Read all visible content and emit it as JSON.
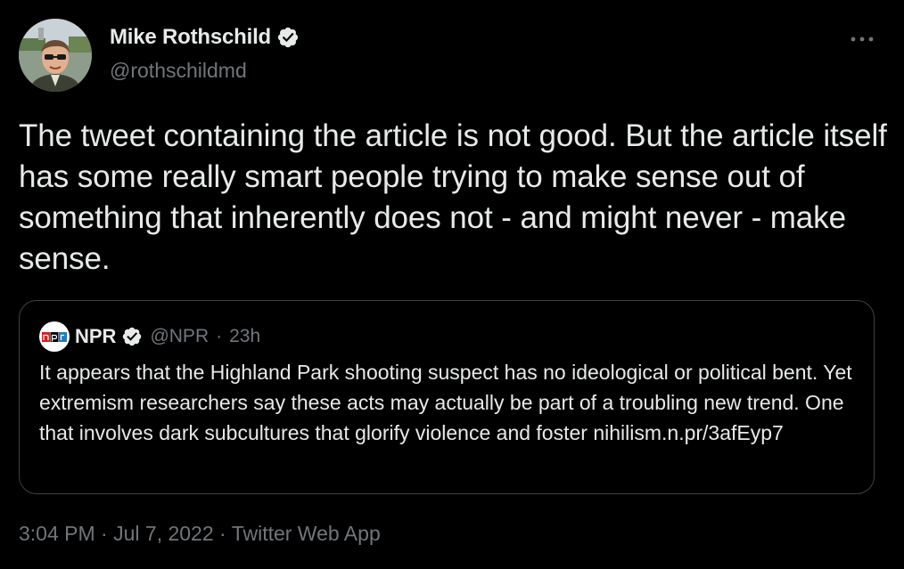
{
  "tweet": {
    "author": {
      "display_name": "Mike Rothschild",
      "handle": "@rothschildmd",
      "verified_icon": "verified-badge-icon"
    },
    "more_icon": "more-options-icon",
    "text": "The tweet containing the article is not good. But the article itself has some really smart people trying to make sense out of something that inherently does not - and might never - make sense.",
    "quoted": {
      "logo": "NPR",
      "display_name": "NPR",
      "handle": "@NPR",
      "separator": "·",
      "time": "23h",
      "text": "It appears that the Highland Park shooting suspect has no ideological or political bent. Yet extremism researchers say these acts may actually be part of a troubling new trend. One that involves dark subcultures that glorify violence and foster nihilism.",
      "link": "n.pr/3afEyp7"
    },
    "meta": {
      "time": "3:04 PM",
      "date": "Jul 7, 2022",
      "source": "Twitter Web App",
      "separator": "·"
    }
  },
  "colors": {
    "background": "#000000",
    "text_primary": "#e7e9ea",
    "text_secondary": "#71767b",
    "border": "#3e4144",
    "npr_red": "#d62021",
    "npr_black": "#000000",
    "npr_blue": "#237bbd"
  }
}
